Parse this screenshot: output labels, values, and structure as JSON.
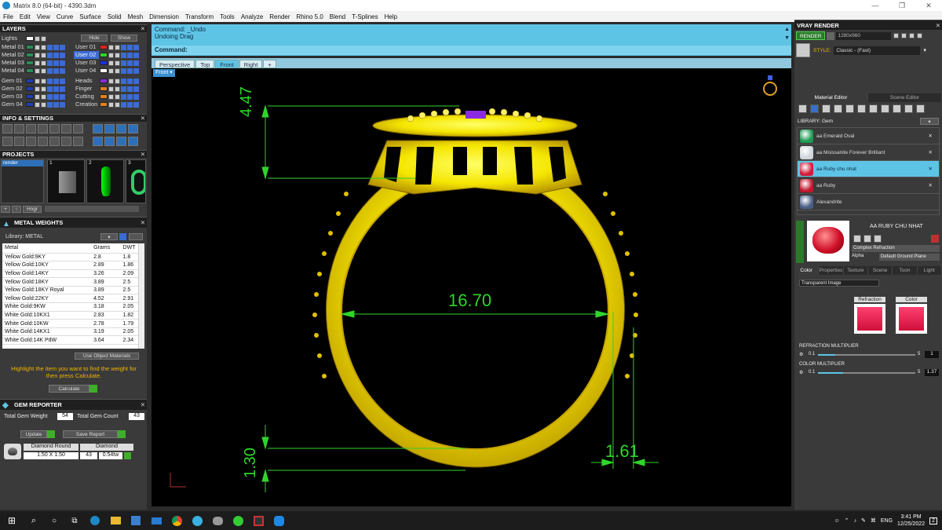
{
  "window": {
    "title": "Matrix 8.0 (64-bit) - 4390.3dm",
    "controls": [
      "—",
      "❐",
      "✕"
    ]
  },
  "menu": [
    "File",
    "Edit",
    "View",
    "Curve",
    "Surface",
    "Solid",
    "Mesh",
    "Dimension",
    "Transform",
    "Tools",
    "Analyze",
    "Render",
    "Rhino 5.0",
    "Blend",
    "T-Splines",
    "Help"
  ],
  "layers": {
    "title": "LAYERS",
    "lights_label": "Lights",
    "hide_label": "Hide",
    "show_label": "Show",
    "left": [
      {
        "name": "Metal 01",
        "color": "#2e8b57"
      },
      {
        "name": "Metal 02",
        "color": "#2e8b57"
      },
      {
        "name": "Metal 03",
        "color": "#2e8b57"
      },
      {
        "name": "Metal 04",
        "color": "#2e8b57"
      },
      {
        "name": "Gem 01",
        "color": "#1e3fb0"
      },
      {
        "name": "Gem 02",
        "color": "#1e3fb0"
      },
      {
        "name": "Gem 03",
        "color": "#1e3fb0"
      },
      {
        "name": "Gem 04",
        "color": "#1e3fb0"
      }
    ],
    "right": [
      {
        "name": "User 01",
        "color": "#e0231f"
      },
      {
        "name": "User 02",
        "color": "#2dd52a"
      },
      {
        "name": "User 03",
        "color": "#1b2ee0"
      },
      {
        "name": "User 04",
        "color": "#ffffff"
      },
      {
        "name": "Heads",
        "color": "#8a2be2"
      },
      {
        "name": "Finger",
        "color": "#e08020"
      },
      {
        "name": "Cutting",
        "color": "#e08020"
      },
      {
        "name": "Creation",
        "color": "#e08020"
      }
    ]
  },
  "info": {
    "title": "INFO & SETTINGS"
  },
  "projects": {
    "title": "PROJECTS",
    "list_item": "render",
    "thumbs": [
      "1",
      "2",
      "3"
    ],
    "hinge_label": "Hngr"
  },
  "metal_weights": {
    "title": "METAL WEIGHTS",
    "library_label": "Library: METAL",
    "columns": [
      "Metal",
      "Grams",
      "DWT"
    ],
    "rows": [
      [
        "Yellow Gold:9KY",
        "2.8",
        "1.8"
      ],
      [
        "Yellow Gold:10KY",
        "2.89",
        "1.86"
      ],
      [
        "Yellow Gold:14KY",
        "3.26",
        "2.09"
      ],
      [
        "Yellow Gold:18KY",
        "3.89",
        "2.5"
      ],
      [
        "Yellow Gold:18KY Royal",
        "3.89",
        "2.5"
      ],
      [
        "Yellow Gold:22KY",
        "4.52",
        "2.91"
      ],
      [
        "White Gold:9KW",
        "3.18",
        "2.05"
      ],
      [
        "White Gold:10KX1",
        "2.83",
        "1.82"
      ],
      [
        "White Gold:10KW",
        "2.78",
        "1.79"
      ],
      [
        "White Gold:14KX1",
        "3.19",
        "2.05"
      ],
      [
        "White Gold:14K PdW",
        "3.64",
        "2.34"
      ]
    ],
    "use_object_materials": "Use Object Materials",
    "hint": "Highlight the item you want to find the weight for then press Calculate.",
    "calculate_label": "Calculate"
  },
  "gem_reporter": {
    "title": "GEM REPORTER",
    "total_weight_label": "Total Gem Weight",
    "total_weight": "54",
    "total_count_label": "Total Gem Count",
    "total_count": "43",
    "update_label": "Update",
    "save_label": "Save Report",
    "gem_shape": "Diamond Round",
    "gem_size": "1.50 X 1.50",
    "gem_material": "Diamond",
    "gem_count": "43",
    "gem_weight": "0.54tw"
  },
  "command": {
    "line1": "Command: _Undo",
    "line2": "Undoing Drag",
    "prompt": "Command:"
  },
  "view_tabs": [
    "Perspective",
    "Top",
    "Front",
    "Right",
    "+"
  ],
  "active_view": "Front",
  "viewport_label": "Front",
  "dims": {
    "top": "4.47",
    "width": "16.70",
    "bottom": "1.30",
    "side": "1.61"
  },
  "vray": {
    "title": "VRAY RENDER",
    "render_label": "RENDER",
    "resolution": "1280x960",
    "style_label": "STYLE:",
    "style_value": "Classic - (Fast)",
    "tab_material": "Material Editor",
    "tab_scene": "Scene Editor",
    "library_label": "LIBRARY: Gem",
    "materials": [
      {
        "name": "aa Emerald Oval",
        "color": "#1e9a52"
      },
      {
        "name": "aa Moissanite Forever Brilliant",
        "color": "#cfd6dc"
      },
      {
        "name": "aa Ruby chu nhat",
        "color": "#d21a3a"
      },
      {
        "name": "aa Ruby",
        "color": "#c0182f"
      },
      {
        "name": "Alexandrite",
        "color": "#4a5f86"
      }
    ],
    "selected_material": "AA RUBY CHU NHAT",
    "material_type": "Complex Refraction",
    "alpha_label": "Alpha",
    "ground_plane": "Default Ground Plane",
    "prop_tabs": [
      "Color",
      "Properties",
      "Texture",
      "Scene",
      "Toon",
      "Light"
    ],
    "transparent_image": "Transparent Image",
    "refraction_label": "Refraction",
    "color_label": "Color",
    "refraction_multiplier_label": "REFRACTION MULTIPLIER",
    "refraction_min": "0.1",
    "refraction_max": "5",
    "refraction_value": "1",
    "refraction_level": 0.18,
    "color_multiplier_label": "COLOR MULTIPLIER",
    "color_min": "0.1",
    "color_max": "5",
    "color_value": "1.37",
    "color_level": 0.26
  },
  "taskbar": {
    "lang": "ENG",
    "time": "3:41 PM",
    "date": "12/25/2022",
    "notifications": "2"
  }
}
